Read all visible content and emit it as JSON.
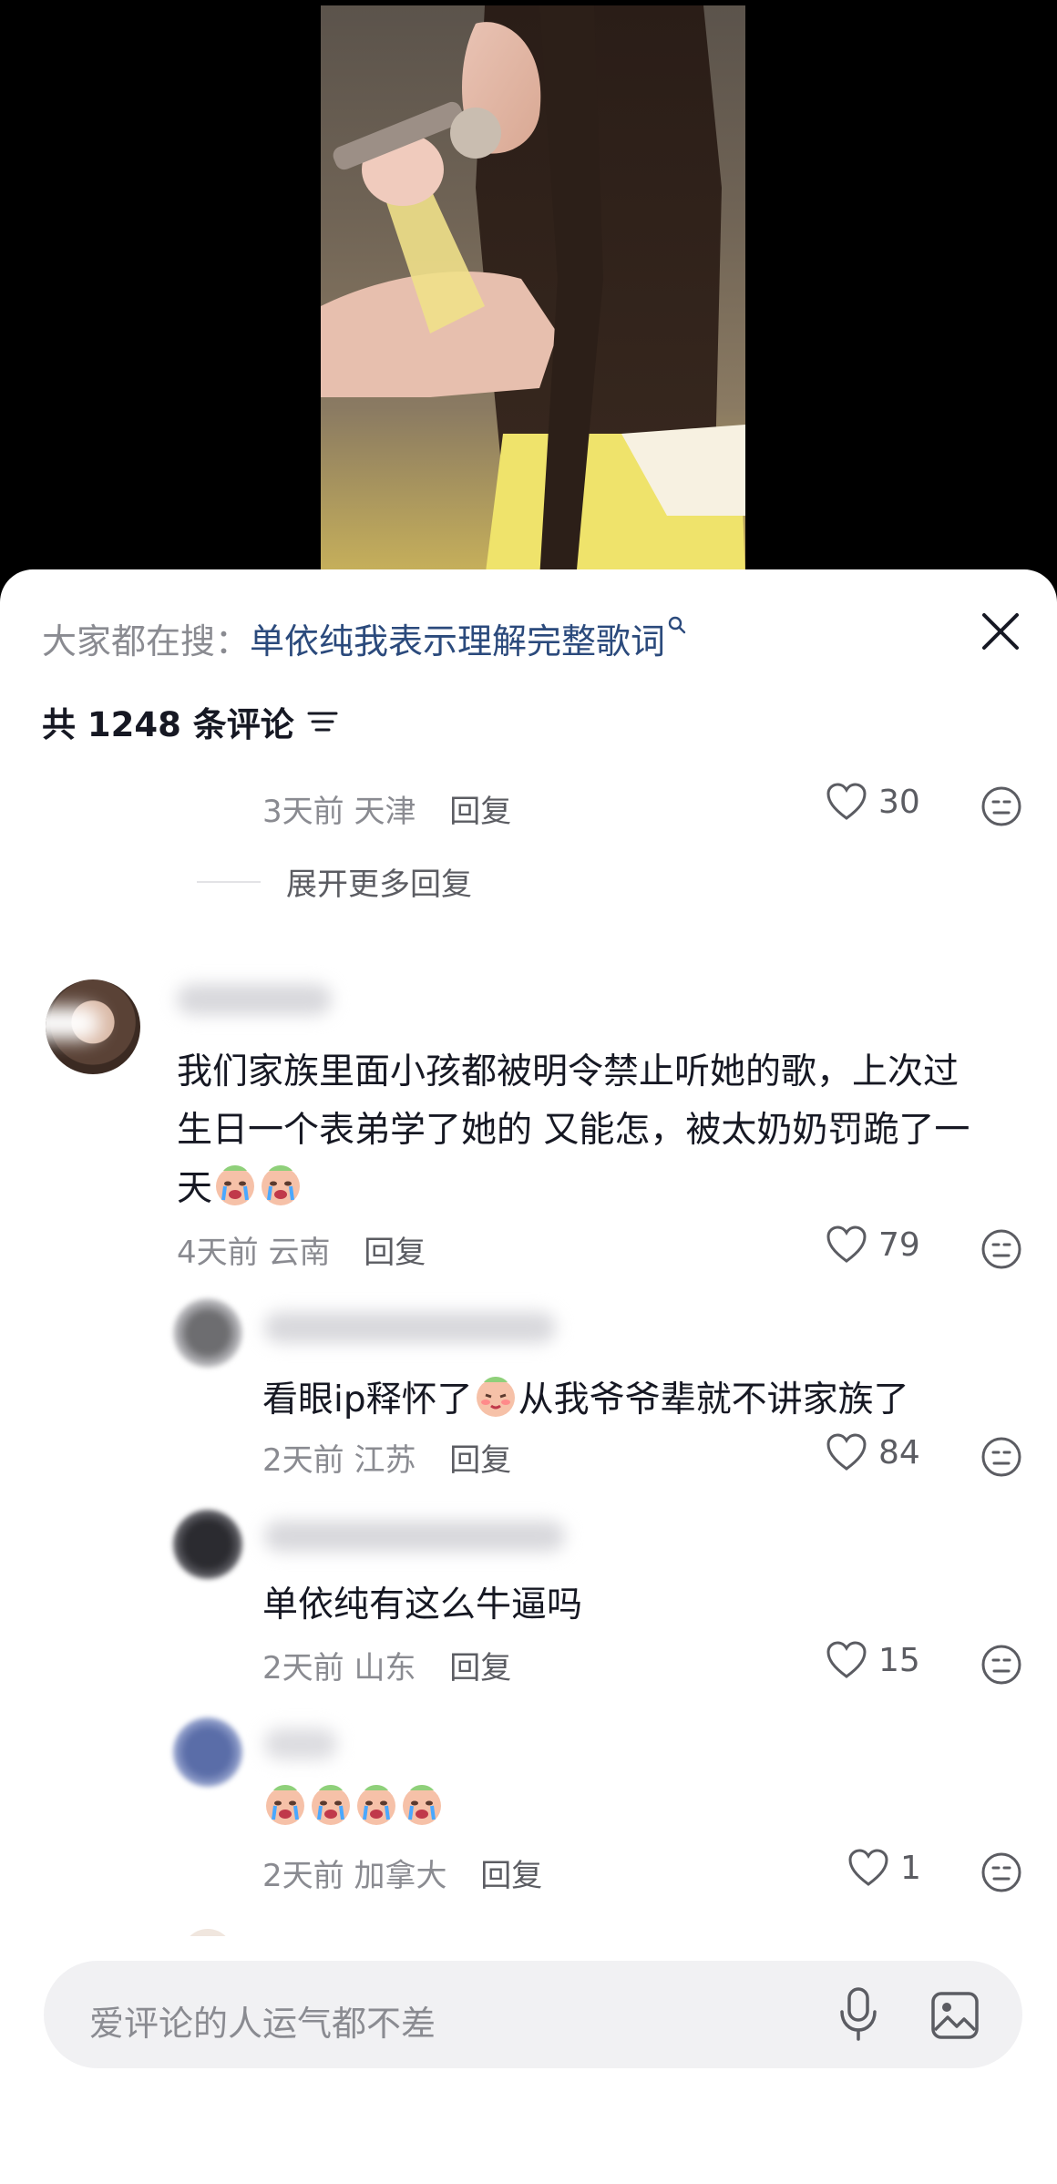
{
  "search": {
    "prefix": "大家都在搜：",
    "term": "单依纯我表示理解完整歌词"
  },
  "header": {
    "count_label": "共 1248 条评论"
  },
  "top_reply": {
    "time": "3天前",
    "location": "天津",
    "reply_label": "回复",
    "likes": "30"
  },
  "expand": {
    "label": "展开更多回复"
  },
  "main_comment": {
    "text": "我们家族里面小孩都被明令禁止听她的歌，上次过生日一个表弟学了她的 又能怎，被太奶奶罚跪了一天",
    "line1": "我们家族里面小孩都被明令禁止听她的歌，上次过",
    "line2": "生日一个表弟学了她的 又能怎，被太奶奶罚跪了一",
    "line3": "天",
    "time": "4天前",
    "location": "云南",
    "reply_label": "回复",
    "likes": "79"
  },
  "replies": [
    {
      "text": "看眼ip释怀了",
      "text_after": "从我爷爷辈就不讲家族了",
      "time": "2天前",
      "location": "江苏",
      "reply_label": "回复",
      "likes": "84"
    },
    {
      "text": "单依纯有这么牛逼吗",
      "time": "2天前",
      "location": "山东",
      "reply_label": "回复",
      "likes": "15"
    },
    {
      "text": "",
      "time": "2天前",
      "location": "加拿大",
      "reply_label": "回复",
      "likes": "1"
    }
  ],
  "input": {
    "placeholder": "爱评论的人运气都不差"
  },
  "icons": {
    "close": "close-icon",
    "filter": "filter-icon",
    "heart": "heart-icon",
    "dislike": "dislike-face-icon",
    "mic": "microphone-icon",
    "image": "image-icon",
    "crying_emoji": "crying-emoji-icon",
    "blush_emoji": "blush-emoji-icon"
  },
  "colors": {
    "search_term": "#2b4a7c",
    "muted": "#8a8b91",
    "text": "#161823"
  }
}
